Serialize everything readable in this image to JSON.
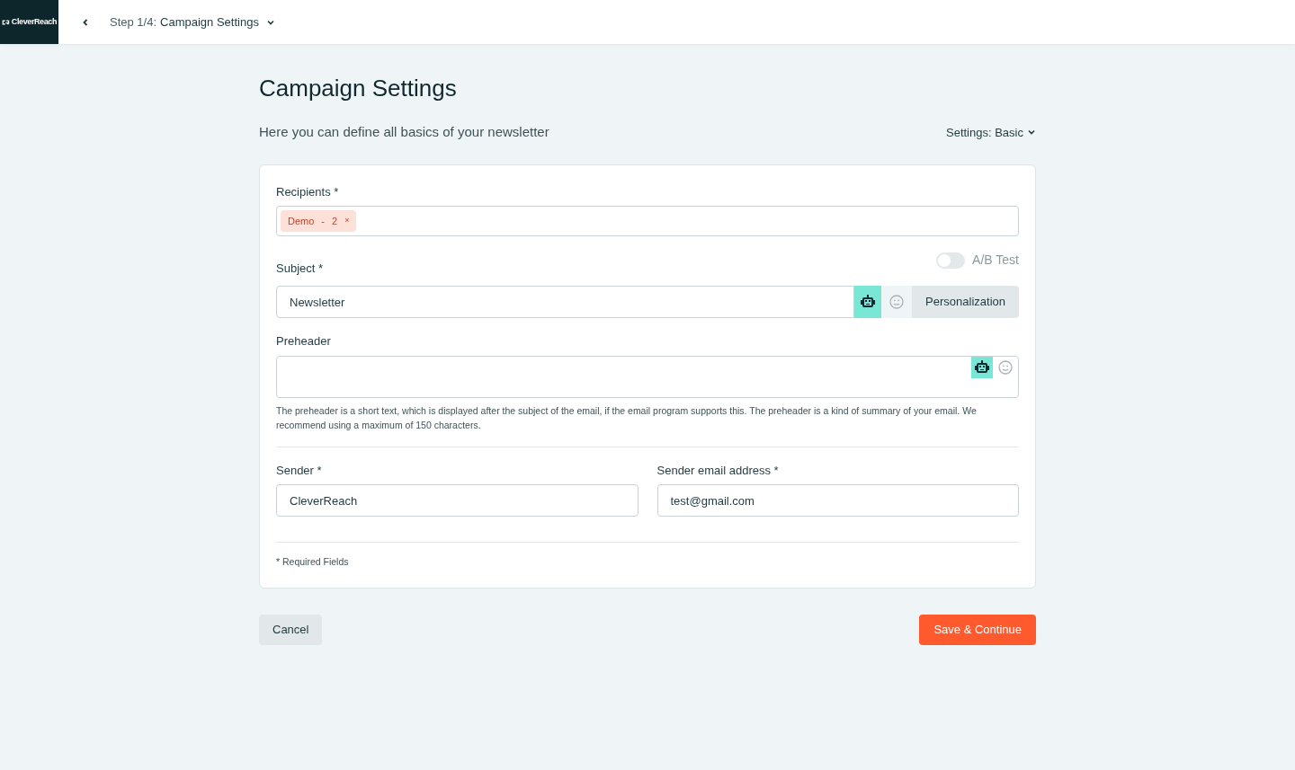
{
  "header": {
    "logo": "CleverReach",
    "step": "Step 1/4:",
    "step_title": "Campaign Settings"
  },
  "page": {
    "title": "Campaign Settings",
    "subtitle": "Here you can define all basics of your newsletter",
    "settings_menu": "Settings: Basic"
  },
  "form": {
    "recipients": {
      "label": "Recipients *",
      "tags": [
        {
          "label": "Demo",
          "separator": "-",
          "count": "2",
          "remove": "×"
        }
      ]
    },
    "subject": {
      "label": "Subject *",
      "value": "Newsletter",
      "ab_test": {
        "label": "A/B Test",
        "on": false
      },
      "personalization": "Personalization"
    },
    "preheader": {
      "label": "Preheader",
      "help": "The preheader is a short text, which is displayed after the subject of the email, if the email program supports this. The preheader is a kind of summary of your email. We recommend using a maximum of 150 characters."
    },
    "sender": {
      "label": "Sender *",
      "value": "CleverReach"
    },
    "sender_email": {
      "label": "Sender email address *",
      "value": "test@gmail.com"
    },
    "required_note": "* Required Fields"
  },
  "buttons": {
    "cancel": "Cancel",
    "save": "Save & Continue"
  }
}
